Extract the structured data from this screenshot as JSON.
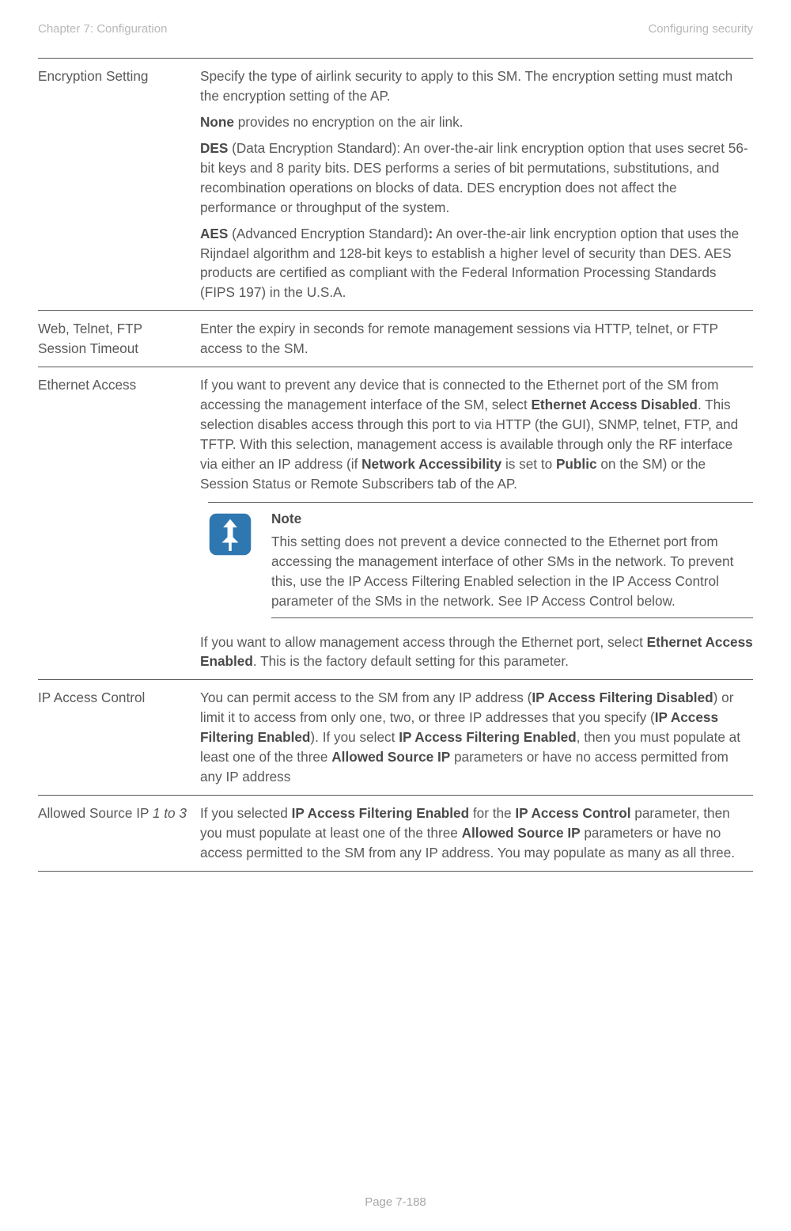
{
  "header": {
    "left": "Chapter 7:  Configuration",
    "right": "Configuring security"
  },
  "rows": {
    "encryption": {
      "term": "Encryption Setting",
      "p1": "Specify the type of airlink security to apply to this SM. The encryption setting must match the encryption setting of the AP.",
      "p2_bold": "None",
      "p2_rest": " provides no encryption on the air link.",
      "p3_bold": "DES",
      "p3_rest": " (Data Encryption Standard): An over-the-air link encryption option that uses secret 56-bit keys and 8 parity bits. DES performs a series of bit permutations, substitutions, and recombination operations on blocks of data. DES encryption does not affect the performance or throughput of the system.",
      "p4_bold": "AES",
      "p4_mid": " (Advanced Encryption Standard)",
      "p4_colon": ":",
      "p4_rest": " An over-the-air link encryption option that uses the Rijndael algorithm and 128-bit keys to establish a higher level of security than DES. AES products are certified as compliant with the Federal Information Processing Standards (FIPS 197) in the U.S.A."
    },
    "web": {
      "term": "Web, Telnet, FTP Session Timeout",
      "p1": "Enter the expiry in seconds for remote management sessions via HTTP, telnet, or FTP access to the SM."
    },
    "eth": {
      "term": "Ethernet Access",
      "p1_a": "If you want to prevent any device that is connected to the Ethernet port of the SM from accessing the management interface of the SM, select ",
      "p1_b": "Ethernet Access Disabled",
      "p1_c": ". This selection disables access through this port to via HTTP (the GUI), SNMP, telnet, FTP, and TFTP. With this selection, management access is available through only the RF interface via either an IP address (if ",
      "p1_d": "Network Accessibility",
      "p1_e": " is set to ",
      "p1_f": "Public",
      "p1_g": " on the SM) or the Session Status or Remote Subscribers tab of the AP.",
      "note_title": "Note",
      "note_body": "This setting does not prevent a device connected to the Ethernet port from accessing the management interface of other SMs in the network. To prevent this, use the IP Access Filtering Enabled selection in the IP Access Control parameter of the SMs in the network. See IP Access Control below.",
      "p2_a": "If you want to allow management access through the Ethernet port, select ",
      "p2_b": "Ethernet Access Enabled",
      "p2_c": ". This is the factory default setting for this parameter."
    },
    "ipac": {
      "term": "IP Access Control",
      "p1_a": "You can permit access to the SM from any IP address (",
      "p1_b": "IP Access Filtering Disabled",
      "p1_c": ") or limit it to access from only one, two, or three IP addresses that you specify (",
      "p1_d": "IP Access Filtering Enabled",
      "p1_e": "). If you select ",
      "p1_f": "IP Access Filtering Enabled",
      "p1_g": ", then you must populate at least one of the three ",
      "p1_h": "Allowed Source IP",
      "p1_i": " parameters or have no access permitted from any IP address"
    },
    "allowed": {
      "term_a": "Allowed Source IP ",
      "term_b": "1 to 3",
      "p1_a": "If you selected ",
      "p1_b": "IP Access Filtering Enabled",
      "p1_c": " for the ",
      "p1_d": "IP Access Control",
      "p1_e": " parameter, then you must populate at least one of the three ",
      "p1_f": "Allowed Source IP",
      "p1_g": " parameters or have no access permitted to the SM from any IP address. You may populate as many as all three."
    }
  },
  "footer": "Page 7-188"
}
